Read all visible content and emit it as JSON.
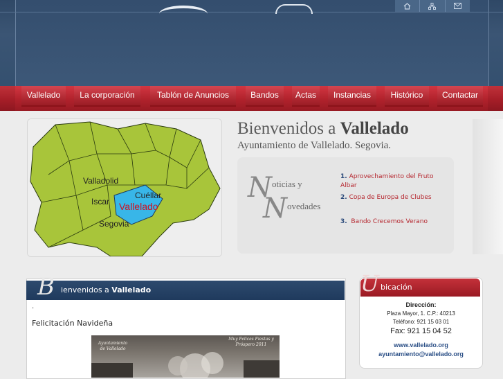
{
  "top_icons": [
    "home-icon",
    "sitemap-icon",
    "mail-icon"
  ],
  "nav": {
    "items": [
      "Vallelado",
      "La corporación",
      "Tablón de Anuncios",
      "Bandos",
      "Actas",
      "Instancias",
      "Histórico",
      "Contactar"
    ]
  },
  "map": {
    "labels": [
      "Valladolid",
      "Iscar",
      "Cuéllar",
      "Vallelado",
      "Segovia"
    ]
  },
  "welcome": {
    "title_prefix": "Bienvenidos a ",
    "title_bold": "Vallelado",
    "subtitle": "Ayuntamiento de Vallelado. Segovia."
  },
  "news": {
    "heading_cap1": "N",
    "heading_word1": "oticias y",
    "heading_cap2": "N",
    "heading_word2": "ovedades",
    "items": [
      {
        "num": "1.",
        "text": "Aprovechamiento del Fruto Albar"
      },
      {
        "num": "2.",
        "text": "Copa de Europa de Clubes"
      },
      {
        "num": "3.",
        "text": "Bando Crecemos Verano"
      }
    ]
  },
  "content": {
    "header_cap": "B",
    "header_text": "ienvenidos a ",
    "header_bold": "Vallelado",
    "dot": ".",
    "post_title": "Felicitación Navideña",
    "card_left": "Ayuntamiento de Vallelado",
    "card_right": "Muy Felices Fiestas y Próspero 2011"
  },
  "ubicacion": {
    "cap": "U",
    "title": "bicación",
    "direccion_label": "Dirección:",
    "address": "Plaza Mayor, 1. C.P.: 40213",
    "telefono": "Teléfono: 921 15 03 01",
    "fax": "Fax:  921 15 04 52",
    "web": "www.vallelado.org",
    "email": "ayuntamiento@vallelado.org"
  }
}
